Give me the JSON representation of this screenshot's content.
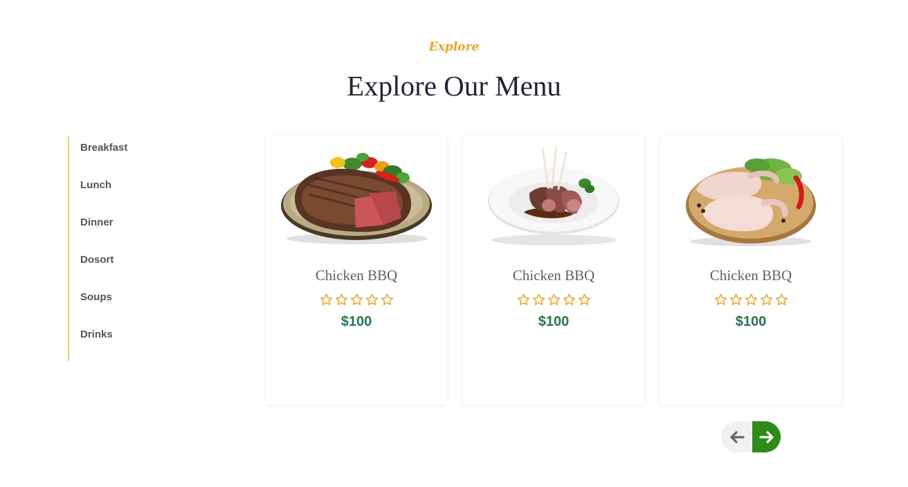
{
  "header": {
    "eyebrow": "Explore",
    "title": "Explore Our Menu"
  },
  "sidebar": {
    "items": [
      {
        "label": "Breakfast"
      },
      {
        "label": "Lunch"
      },
      {
        "label": "Dinner"
      },
      {
        "label": "Dosort"
      },
      {
        "label": "Soups"
      },
      {
        "label": "Drinks"
      }
    ]
  },
  "cards": [
    {
      "name": "Chicken BBQ",
      "price": "$100",
      "rating": 0,
      "max_rating": 5,
      "image": "steak-plate-image"
    },
    {
      "name": "Chicken BBQ",
      "price": "$100",
      "rating": 0,
      "max_rating": 5,
      "image": "lamb-chops-image"
    },
    {
      "name": "Chicken BBQ",
      "price": "$100",
      "rating": 0,
      "max_rating": 5,
      "image": "raw-chicken-board-image"
    }
  ],
  "pagination": {
    "prev_icon": "arrow-left-icon",
    "next_icon": "arrow-right-icon"
  },
  "colors": {
    "accent": "#f7a21b",
    "price": "#1f7a4a",
    "next_button": "#2c8c16",
    "sidebar_rule": "#f5cf57",
    "star": "#f7a21b"
  }
}
